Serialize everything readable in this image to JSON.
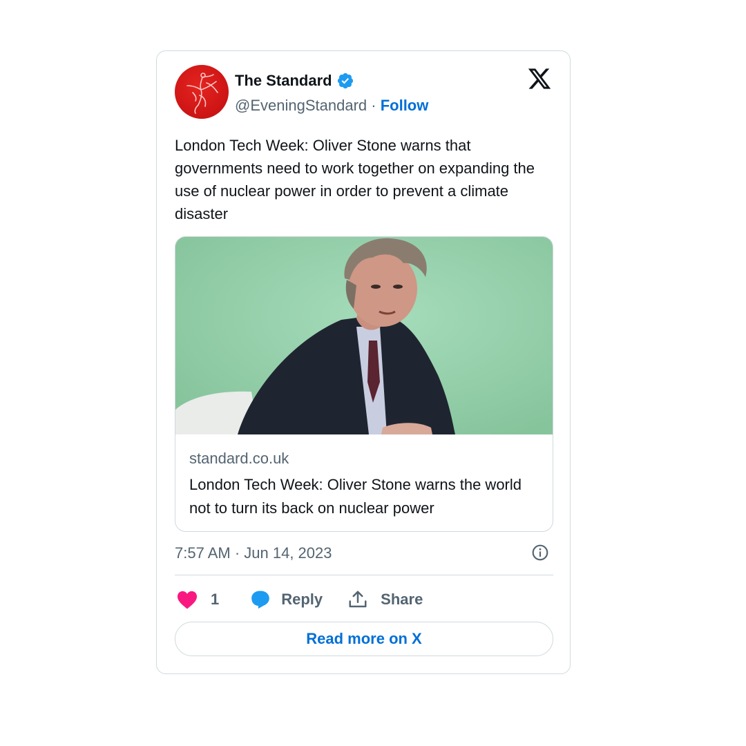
{
  "author": {
    "name": "The Standard",
    "handle": "@EveningStandard",
    "separator": "·",
    "follow_label": "Follow",
    "verified": true
  },
  "tweet": {
    "text": "London Tech Week: Oliver Stone warns that governments need to work together on expanding the use of nuclear power in order to prevent a climate disaster"
  },
  "link_card": {
    "domain": "standard.co.uk",
    "title": "London Tech Week: Oliver Stone warns the world not to turn its back on nuclear power"
  },
  "meta": {
    "timestamp": "7:57 AM · Jun 14, 2023"
  },
  "actions": {
    "like_count": "1",
    "reply_label": "Reply",
    "share_label": "Share"
  },
  "footer": {
    "read_more_label": "Read more on X"
  },
  "colors": {
    "link_blue": "#006fd6",
    "verified_blue": "#1d9bf0",
    "like_pink": "#f91880",
    "text_secondary": "#536471",
    "border": "#cfd9de",
    "avatar_red": "#d31a17"
  },
  "icons": {
    "brand": "x-logo-icon",
    "verified": "verified-badge-icon",
    "info": "info-icon",
    "like": "heart-icon",
    "reply": "speech-bubble-icon",
    "share": "share-upload-icon"
  }
}
